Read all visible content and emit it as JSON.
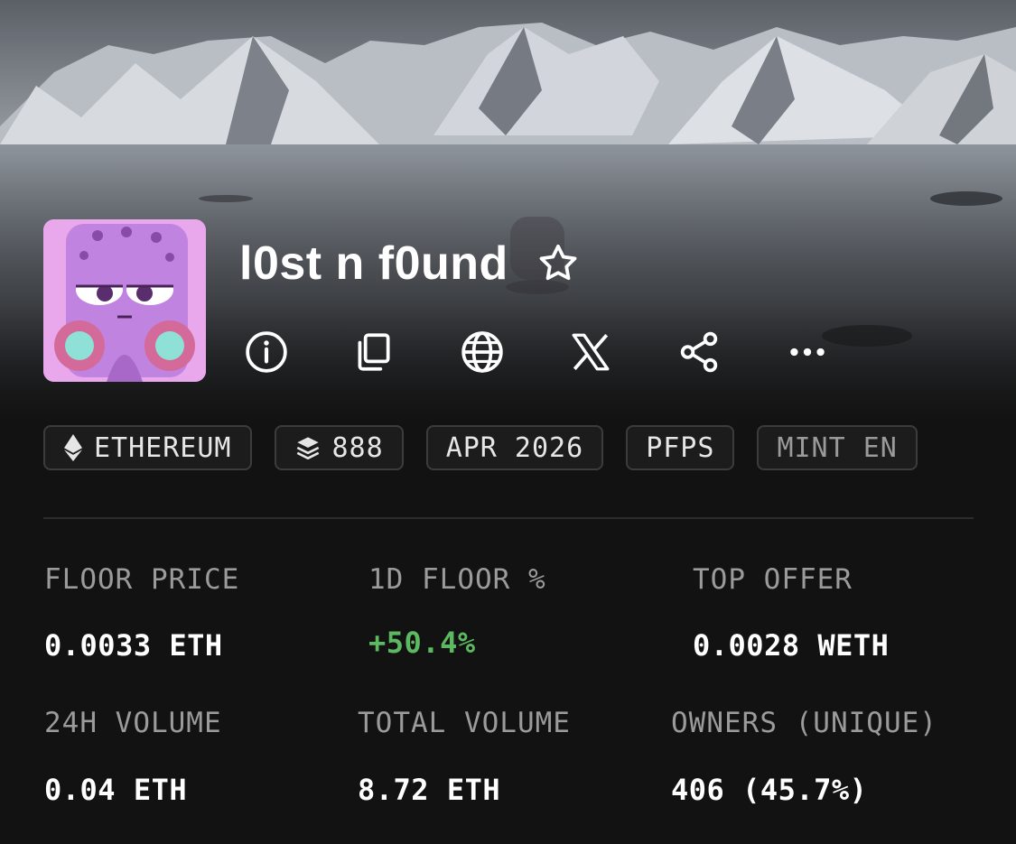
{
  "collection": {
    "name": "l0st n f0und",
    "avatar_alt": "purple octopus character"
  },
  "actions": [
    {
      "name": "info-icon"
    },
    {
      "name": "copy-icon"
    },
    {
      "name": "globe-icon"
    },
    {
      "name": "x-icon"
    },
    {
      "name": "share-icon"
    },
    {
      "name": "more-icon"
    }
  ],
  "chips": {
    "chain": "ETHEREUM",
    "items": "888",
    "date": "APR 2026",
    "category": "PFPS",
    "partial": "MINT EN"
  },
  "stats": {
    "floor_price": {
      "label": "FLOOR PRICE",
      "value": "0.0033 ETH"
    },
    "floor_change": {
      "label": "1D FLOOR %",
      "value": "+50.4%"
    },
    "top_offer": {
      "label": "TOP OFFER",
      "value": "0.0028 WETH"
    },
    "volume_24h": {
      "label": "24H VOLUME",
      "value": "0.04 ETH"
    },
    "total_volume": {
      "label": "TOTAL VOLUME",
      "value": "8.72 ETH"
    },
    "owners": {
      "label": "OWNERS (UNIQUE)",
      "value": "406 (45.7%)"
    }
  },
  "colors": {
    "background": "#121212",
    "positive": "#5cb861",
    "label": "#9b9b9b",
    "avatar": "#e9a8ec"
  }
}
